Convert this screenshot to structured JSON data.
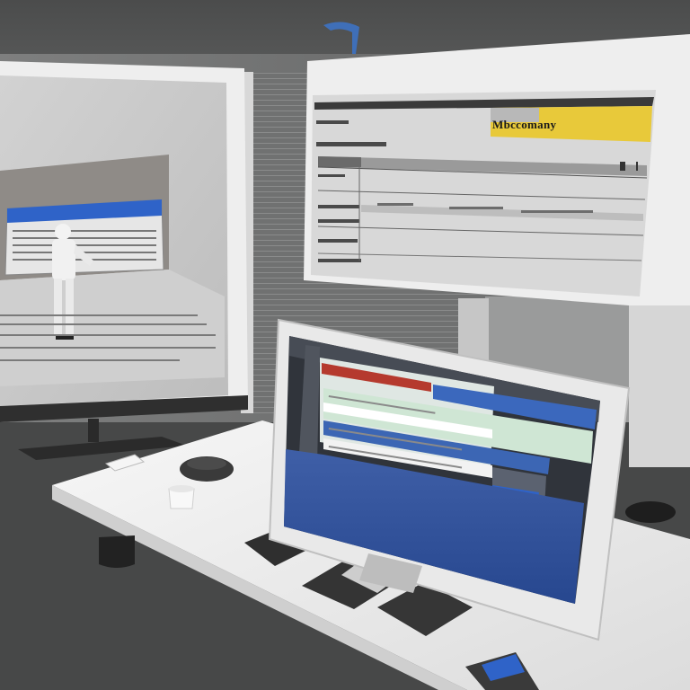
{
  "colors": {
    "ceiling": "#4e4f4f",
    "wall": "#6a6b6b",
    "desk": "#f2f2f2",
    "floor": "#3d3e3e",
    "accent_blue": "#2f63c8",
    "banner_yellow": "#e8c93a",
    "panel_gray": "#c9c9c9"
  },
  "right_monitor": {
    "banner_text": "Mbccomany",
    "icons": [
      "window-icon",
      "close-icon"
    ]
  },
  "objects": [
    "left-monitor",
    "right-monitor",
    "front-monitor",
    "desk",
    "keyboard",
    "mouse",
    "cup",
    "bin",
    "person"
  ]
}
